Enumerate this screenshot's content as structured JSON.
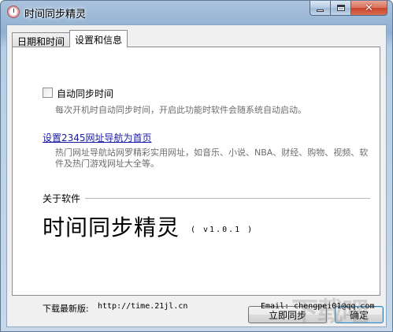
{
  "window": {
    "title": "时间同步精灵",
    "close_glyph": "✕"
  },
  "tabs": [
    {
      "label": "日期和时间",
      "active": false
    },
    {
      "label": "设置和信息",
      "active": true
    }
  ],
  "settings": {
    "auto_sync_label": "自动同步时间",
    "auto_sync_checked": false,
    "auto_sync_hint": "每次开机时自动同步时间，开启此功能时软件会随系统自动启动。",
    "homepage_link": "设置2345网址导航为首页",
    "homepage_hint": "热门网址导航站网罗精彩实用网址，如音乐、小说、NBA、财经、购物、视频、软件及热门游戏网址大全等。"
  },
  "about": {
    "heading": "关于软件",
    "app_name": "时间同步精灵",
    "version": "( v1.0.1 )",
    "download_label": "下载最新版:",
    "download_url": "http://time.21jl.cn",
    "email": "Email: chengpei01@qq.com"
  },
  "buttons": {
    "sync_now": "立即同步",
    "ok": "确定"
  },
  "watermark": "下载吧"
}
